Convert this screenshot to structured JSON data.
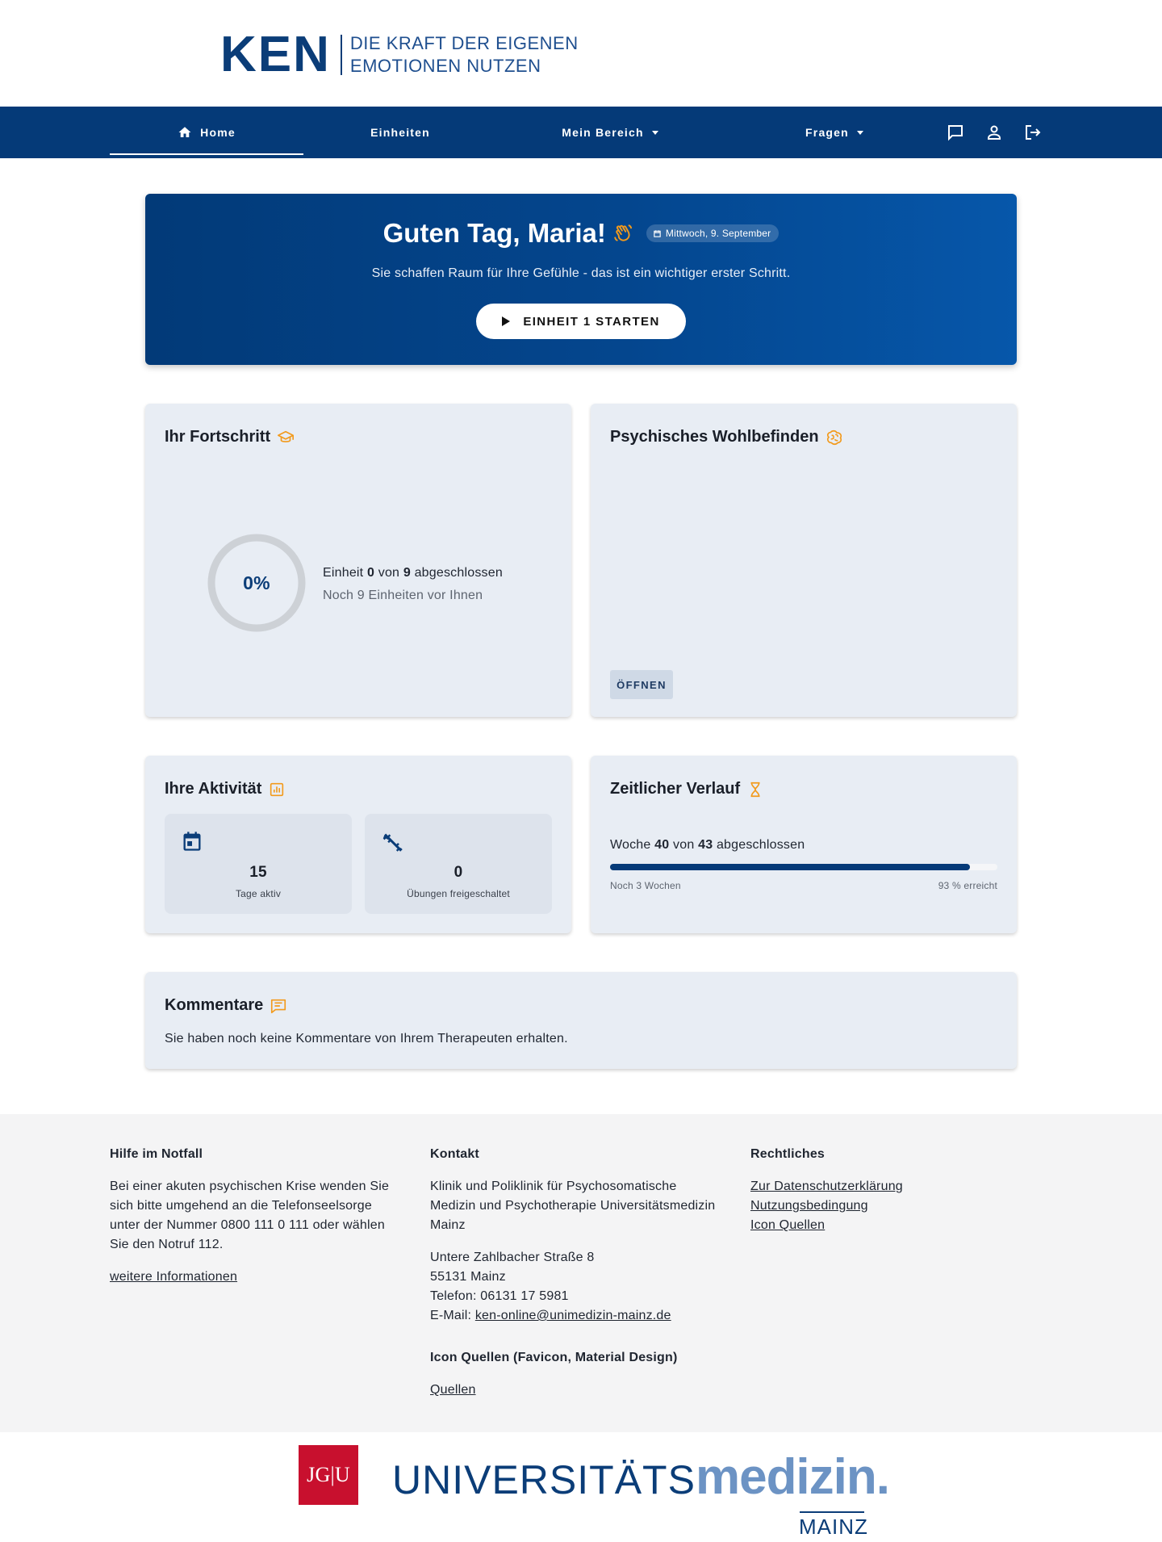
{
  "brand": {
    "logo_text": "KEN",
    "tagline_line1": "DIE KRAFT DER EIGENEN",
    "tagline_line2": "EMOTIONEN NUTZEN"
  },
  "nav": {
    "home": "Home",
    "units": "Einheiten",
    "my_area": "Mein Bereich",
    "questions": "Fragen"
  },
  "hero": {
    "greeting": "Guten Tag, Maria!",
    "date": "Mittwoch, 9. September",
    "subtitle": "Sie schaffen Raum für Ihre Gefühle - das ist ein wichtiger erster Schritt.",
    "button_label": "EINHEIT 1 STARTEN"
  },
  "progress": {
    "title": "Ihr Fortschritt",
    "percent_label": "0%",
    "percent": 0,
    "prefix": "Einheit",
    "done": "0",
    "of": "von",
    "total": "9",
    "suffix": "abgeschlossen",
    "remaining": "Noch 9 Einheiten vor Ihnen"
  },
  "wellbeing": {
    "title": "Psychisches Wohlbefinden",
    "button_label": "ÖFFNEN"
  },
  "activity": {
    "title": "Ihre Aktivität",
    "days_value": "15",
    "days_label": "Tage aktiv",
    "exercises_value": "0",
    "exercises_label": "Übungen freigeschaltet"
  },
  "timeline": {
    "title": "Zeitlicher Verlauf",
    "prefix": "Woche",
    "week_done": "40",
    "of": "von",
    "week_total": "43",
    "suffix": "abgeschlossen",
    "remaining": "Noch 3 Wochen",
    "percent_label": "93 % erreicht",
    "percent": 93
  },
  "comments": {
    "title": "Kommentare",
    "text": "Sie haben noch keine Kommentare von Ihrem Therapeuten erhalten."
  },
  "footer": {
    "emergency": {
      "title": "Hilfe im Notfall",
      "text": "Bei einer akuten psychischen Krise wenden Sie sich bitte umgehend an die Telefonseelsorge unter der Nummer 0800 111 0 111 oder wählen Sie den Notruf 112.",
      "link": "weitere Informationen"
    },
    "contact": {
      "title": "Kontakt",
      "org": "Klinik und Poliklinik für Psychosomatische Medizin und Psychotherapie Universitätsmedizin Mainz",
      "street": "Untere Zahlbacher Straße 8",
      "city": "55131 Mainz",
      "phone": "Telefon: 06131 17 5981",
      "email_prefix": "E-Mail: ",
      "email": "ken-online@unimedizin-mainz.de",
      "icon_title": "Icon Quellen (Favicon, Material Design)",
      "icon_link": "Quellen"
    },
    "legal": {
      "title": "Rechtliches",
      "links": [
        "Zur Datenschutzerklärung",
        "Nutzungsbedingung",
        "Icon Quellen"
      ]
    }
  },
  "logos": {
    "jgu": "JG|U",
    "uni_part1": "UNIVERSITÄTS",
    "uni_part2": "medizin.",
    "city": "MAINZ"
  },
  "colors": {
    "primary": "#053a78",
    "accent": "#f29a1c",
    "card": "#e8edf4"
  }
}
